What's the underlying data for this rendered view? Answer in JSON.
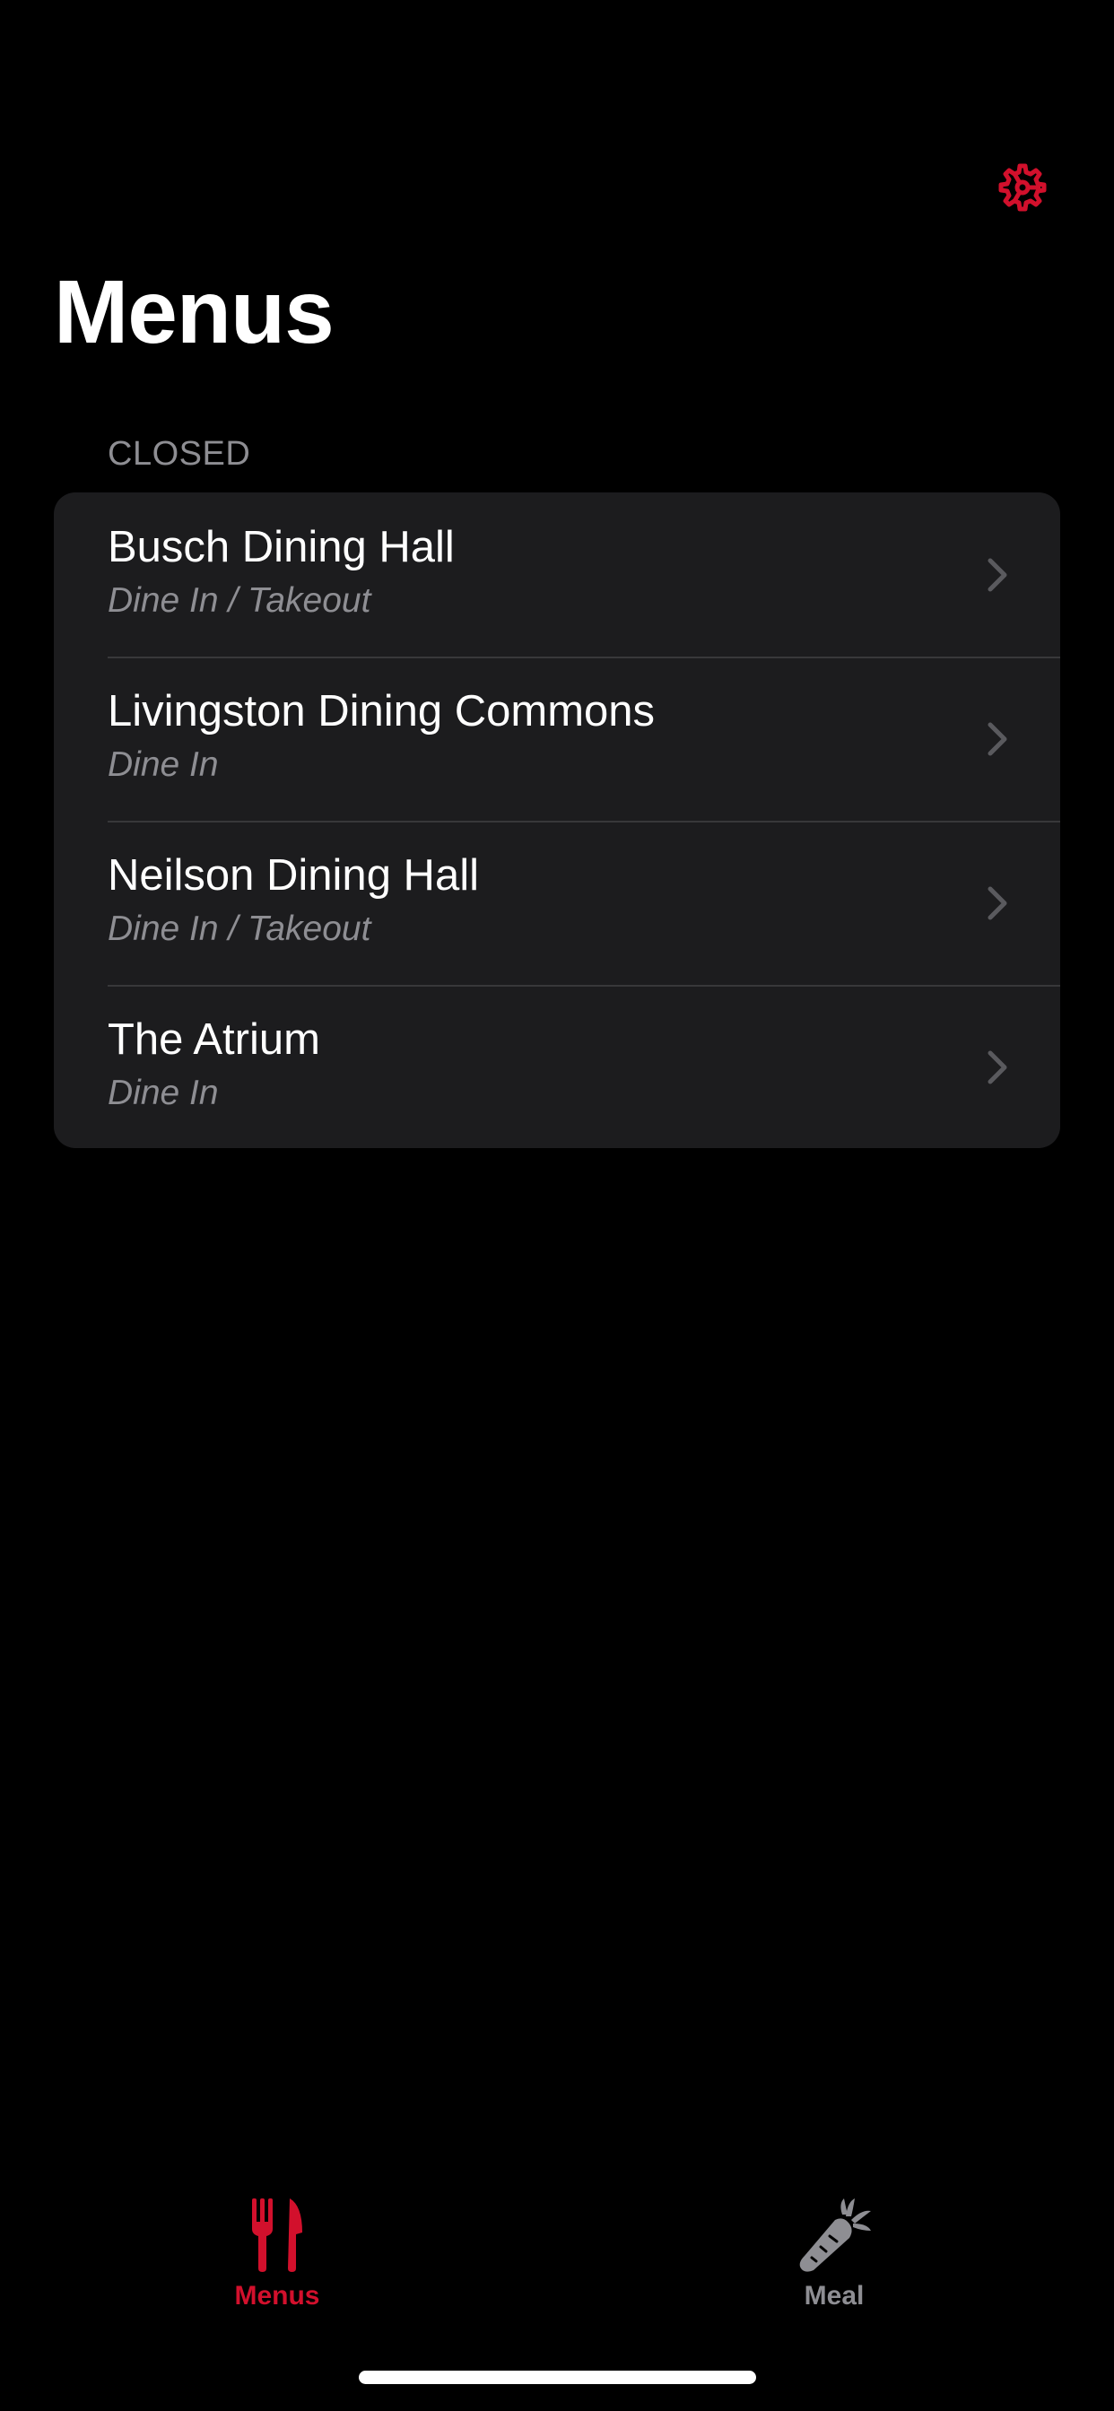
{
  "colors": {
    "accent": "#d2102c",
    "background": "#000000",
    "card": "#1c1c1e",
    "secondary_text": "#8e8e93",
    "inactive_tab": "#8e8e93",
    "separator": "#38383a"
  },
  "header": {
    "settings_icon": "gear-icon",
    "title": "Menus"
  },
  "section": {
    "header": "CLOSED"
  },
  "dining_halls": [
    {
      "name": "Busch Dining Hall",
      "service": "Dine In / Takeout"
    },
    {
      "name": "Livingston Dining Commons",
      "service": "Dine In"
    },
    {
      "name": "Neilson Dining Hall",
      "service": "Dine In / Takeout"
    },
    {
      "name": "The Atrium",
      "service": "Dine In"
    }
  ],
  "tab_bar": {
    "selected": "Menus",
    "tabs": [
      {
        "label": "Menus",
        "icon": "fork-knife-icon"
      },
      {
        "label": "Meal",
        "icon": "carrot-icon"
      }
    ]
  }
}
